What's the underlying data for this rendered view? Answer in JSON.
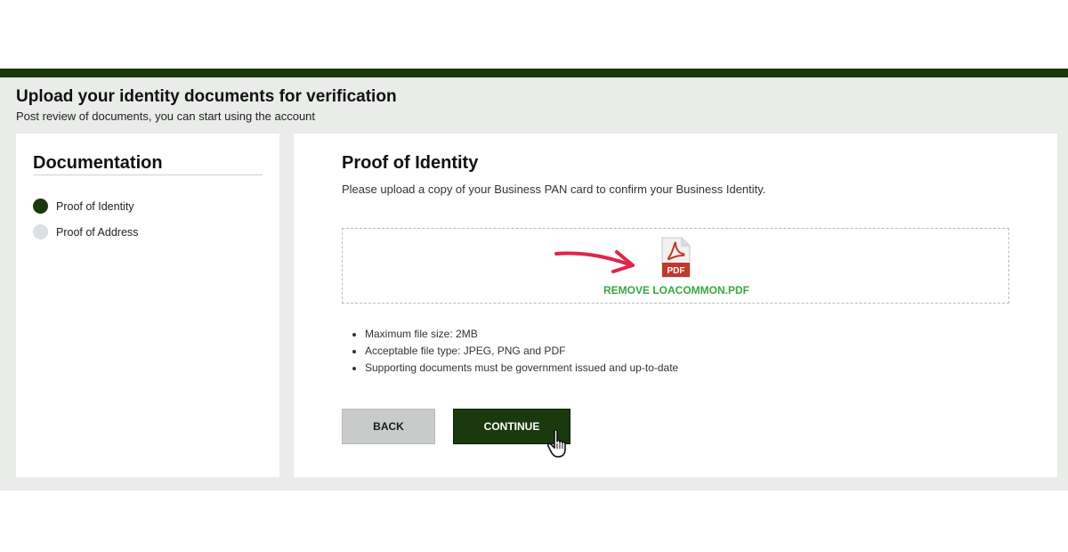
{
  "header": {
    "title": "Upload your identity documents for verification",
    "subtitle": "Post review of documents, you can start using the account"
  },
  "sidebar": {
    "title": "Documentation",
    "steps": [
      {
        "label": "Proof of Identity",
        "status": "active"
      },
      {
        "label": "Proof of Address",
        "status": "inactive"
      }
    ]
  },
  "main": {
    "title": "Proof of Identity",
    "description": "Please upload a copy of your Business PAN card to confirm your Business Identity.",
    "upload": {
      "file_type_badge": "PDF",
      "remove_label": "REMOVE LOACOMMON.PDF"
    },
    "requirements": [
      "Maximum file size: 2MB",
      "Acceptable file type: JPEG, PNG and PDF",
      "Supporting documents must be government issued and up-to-date"
    ],
    "buttons": {
      "back_label": "BACK",
      "continue_label": "CONTINUE"
    }
  },
  "colors": {
    "brand": "#1a3a0e",
    "link": "#3aa641",
    "annotation_arrow": "#e0244a",
    "pdf_red": "#c0392b"
  },
  "icons": {
    "file": "pdf-file-icon",
    "annotation": "arrow-right-icon",
    "pointer": "hand-pointer-icon"
  }
}
